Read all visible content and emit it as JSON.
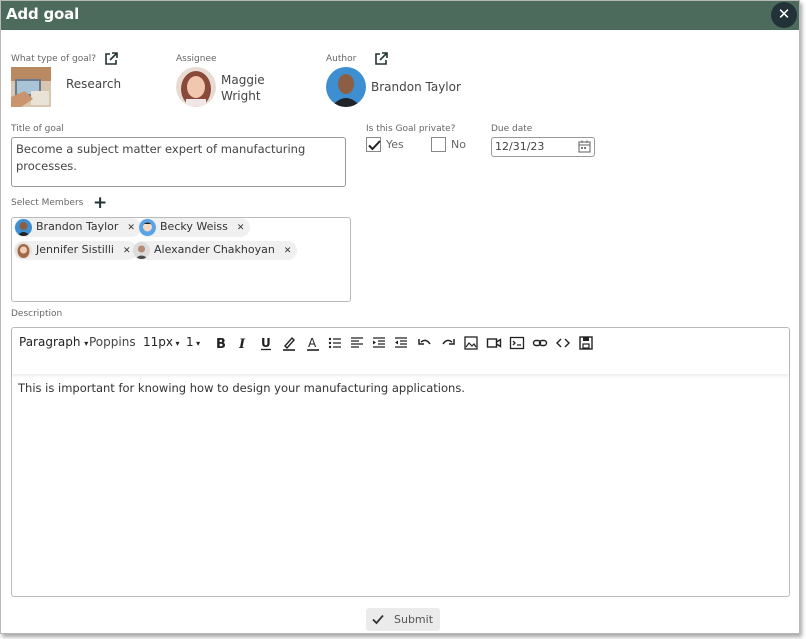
{
  "dialog": {
    "title": "Add goal",
    "close_label": "✕"
  },
  "goal_type": {
    "label": "What type of goal?",
    "value": "Research"
  },
  "assignee": {
    "label": "Assignee",
    "name_line1": "Maggie",
    "name_line2": "Wright"
  },
  "author": {
    "label": "Author",
    "name": "Brandon Taylor"
  },
  "title_of_goal": {
    "label": "Title of goal",
    "value": "Become a subject matter expert of manufacturing processes."
  },
  "privacy": {
    "label": "Is this Goal private?",
    "yes_label": "Yes",
    "no_label": "No",
    "yes_checked": true
  },
  "due_date": {
    "label": "Due date",
    "value": "12/31/23"
  },
  "members": {
    "label": "Select Members",
    "add_label": "+",
    "chips": [
      {
        "name": "Brandon Taylor"
      },
      {
        "name": "Becky Weiss"
      },
      {
        "name": "Jennifer Sistilli"
      },
      {
        "name": "Alexander Chakhoyan"
      }
    ],
    "remove_label": "✕"
  },
  "description": {
    "label": "Description",
    "toolbar": {
      "block": "Paragraph",
      "font": "Poppins",
      "size": "11px",
      "line_height": "1"
    },
    "content": "This is important for knowing how to design your manufacturing applications."
  },
  "submit": {
    "label": "Submit"
  },
  "colors": {
    "titlebar": "#4c6b5c",
    "close_bg": "#233238"
  }
}
